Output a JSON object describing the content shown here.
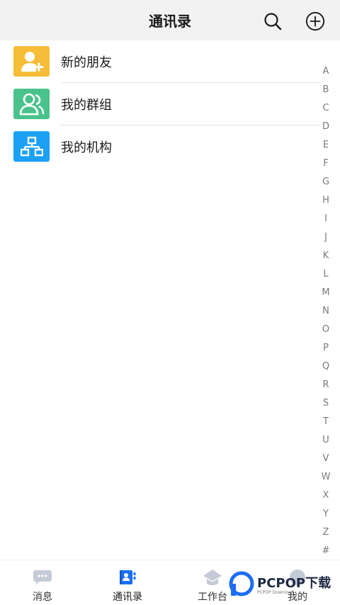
{
  "header": {
    "title": "通讯录",
    "search_icon": "search-icon",
    "add_icon": "plus-circle-icon"
  },
  "list": {
    "items": [
      {
        "label": "新的朋友",
        "icon": "add-user-icon",
        "color": "#f6bd38"
      },
      {
        "label": "我的群组",
        "icon": "group-icon",
        "color": "#4ac28c"
      },
      {
        "label": "我的机构",
        "icon": "org-chart-icon",
        "color": "#1aa1f5"
      }
    ]
  },
  "index": [
    "A",
    "B",
    "C",
    "D",
    "E",
    "F",
    "G",
    "H",
    "I",
    "J",
    "K",
    "L",
    "M",
    "N",
    "O",
    "P",
    "Q",
    "R",
    "S",
    "T",
    "U",
    "V",
    "W",
    "X",
    "Y",
    "Z",
    "#"
  ],
  "tabbar": {
    "tabs": [
      {
        "label": "消息",
        "icon": "message-icon"
      },
      {
        "label": "通讯录",
        "icon": "contacts-icon",
        "active": true
      },
      {
        "label": "工作台",
        "icon": "workbench-icon"
      },
      {
        "label": "我的",
        "icon": "profile-icon"
      }
    ],
    "active_color": "#1b6ef3",
    "inactive_color": "#c5cbd6"
  },
  "watermark": {
    "text": "PCPOP下载",
    "subtext": "PCPOP Download"
  }
}
